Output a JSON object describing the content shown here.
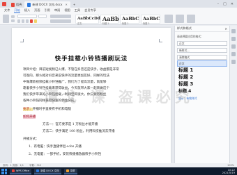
{
  "tabs": [
    {
      "label": "稻壳",
      "type": "pdf"
    },
    {
      "label": "新建 DOCX 文档.docx",
      "type": "doc",
      "active": true
    }
  ],
  "menu": [
    "文件",
    "开始",
    "插入",
    "页面",
    "引用",
    "审阅",
    "视图",
    "工具",
    "会员专享"
  ],
  "menu_active": "开始",
  "styles": [
    {
      "sample": "AaBbCcDd",
      "caption": "正文"
    },
    {
      "sample": "AaBb",
      "caption": "标题 1"
    },
    {
      "sample": "AaBbC",
      "caption": "标题 2"
    },
    {
      "sample": "AaBbC",
      "caption": "标题 3"
    }
  ],
  "document": {
    "title": "快手挂载小铃铛播刷玩法",
    "lines": [
      "项目介绍：目前短视频已火爆，不管在抖音还是快手，收益都是非常",
      "可观的，那么相对抖音来说快手的流量更加友好，同样的玩法",
      "中做爆款视频挂载小铃铛推广，我们为了提高流量，就能够",
      "靠着快手小铃铛挂载来获得收益，今天就带大家一起来做这个",
      "我们快手带来的小铃铛挂载，利润空间很大，你只要有粉丝",
      "各种小铃铛同样获得快速的佣金分成。"
    ],
    "req_label": "要求：",
    "req_text": "开播时手里要有手机和电脑",
    "hint_label": "如何开播",
    "methods": [
      "方法一：官方要求是 1 万粉丝才能开播",
      "方法二：快手满足 100 粉丝，利用科技推流去开播"
    ],
    "tools_label": "开播方式：",
    "steps": [
      "1、有电脑：快手直播伴侣+obs 开播",
      "2、无电脑：一部手机，安装快播播放器快手小铃铛"
    ]
  },
  "panel": {
    "title": "样式和格式",
    "current_label": "请选择要应用的格式：",
    "current_value": "正文",
    "new_style": "新样式...",
    "clear_format": "清除格式",
    "items": [
      "正文",
      "标题 1",
      "标题 2",
      "标题 3",
      "标题 4"
    ],
    "show_label": "显示：有效样式"
  },
  "watermark": "谭戈    课    盗课必究",
  "status": {
    "page": "页码：1  页面：1/1",
    "words": "字数：312",
    "zoom": "100%"
  },
  "taskbar": {
    "apps": [
      {
        "label": "WPS Office",
        "color": "#e8453c"
      },
      {
        "label": "新建 DOCX 文档",
        "color": "#2b79e0"
      },
      {
        "label": "录屏",
        "color": "#f0a030"
      }
    ],
    "time": "10:22",
    "date": "2021/5/19"
  }
}
